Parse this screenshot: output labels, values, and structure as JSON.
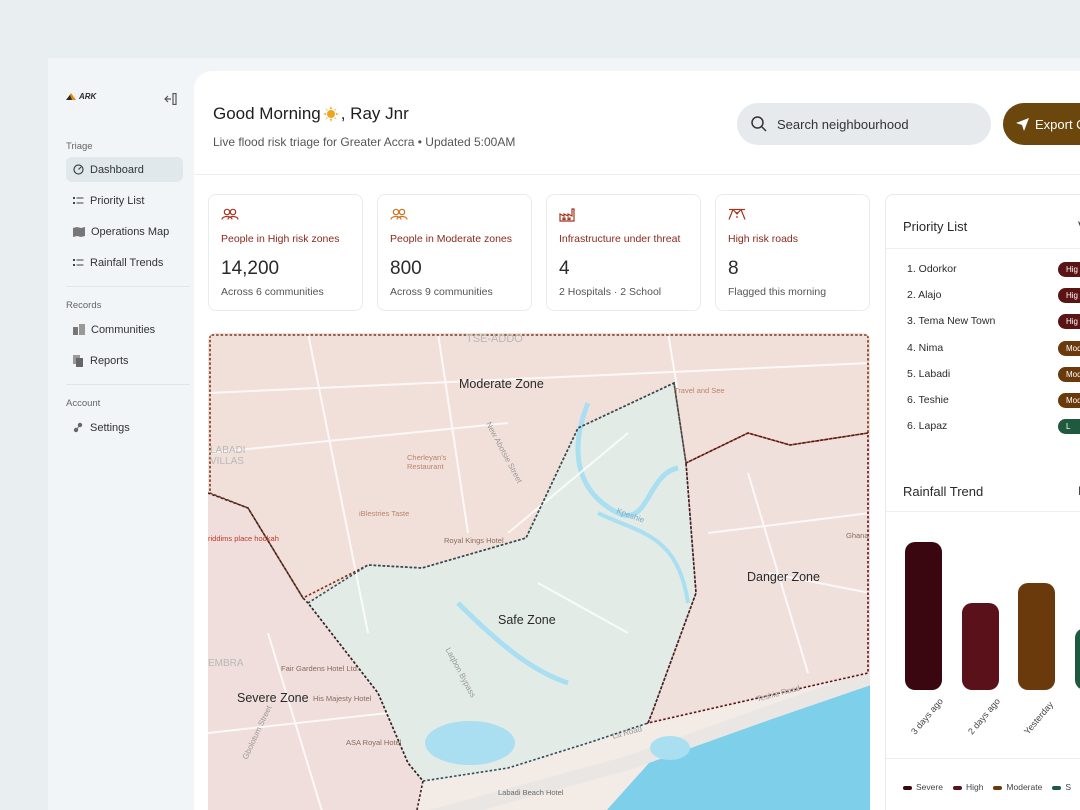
{
  "brand": {
    "name": "ARK"
  },
  "sidebar": {
    "sections": [
      {
        "title": "Triage",
        "items": [
          {
            "label": "Dashboard",
            "icon": "dashboard-icon",
            "active": true
          },
          {
            "label": "Priority List",
            "icon": "list-icon"
          },
          {
            "label": "Operations Map",
            "icon": "map-icon"
          },
          {
            "label": "Rainfall Trends",
            "icon": "list-icon"
          }
        ]
      },
      {
        "title": "Records",
        "items": [
          {
            "label": "Communities",
            "icon": "buildings-icon"
          },
          {
            "label": "Reports",
            "icon": "reports-icon"
          }
        ]
      },
      {
        "title": "Account",
        "items": [
          {
            "label": "Settings",
            "icon": "settings-icon"
          }
        ]
      }
    ]
  },
  "header": {
    "greeting_prefix": "Good Morning",
    "greeting_name": ", Ray Jnr",
    "subtitle": "Live flood risk triage for  Greater Accra • Updated 5:00AM",
    "search_placeholder": "Search neighbourhood",
    "export_label": "Export C"
  },
  "stats": [
    {
      "label": "People in High risk zones",
      "value": "14,200",
      "note": "Across 6 communities",
      "icon": "people-icon"
    },
    {
      "label": "People in Moderate zones",
      "value": "800",
      "note": "Across 9 communities",
      "icon": "people-icon"
    },
    {
      "label": "Infrastructure under threat",
      "value": "4",
      "note": "2 Hospitals · 2 School",
      "icon": "factory-icon"
    },
    {
      "label": "High risk roads",
      "value": "8",
      "note": "Flagged this morning",
      "icon": "road-icon"
    }
  ],
  "map": {
    "zones": [
      "Moderate Zone",
      "Safe Zone",
      "Danger Zone",
      "Severe Zone"
    ],
    "places": [
      "TSE-ADDO",
      "Cherleyan's Restaurant",
      "iBlestries Taste",
      "Royal Kings Hotel",
      "Fair Gardens Hotel Ltd.",
      "His Majesty Hotel",
      "ASA Royal Hotel",
      "Labadi Beach Hotel",
      "Travel and See",
      "Ghana",
      "riddims place hookah"
    ],
    "streets": [
      "New Abotsie Street",
      "Laqbon Bypass",
      "Teshie Road",
      "La Road",
      "Kpeshie",
      "LABADI VILLAS",
      "EMBRA",
      "Gbolotum Street"
    ]
  },
  "priority_list": {
    "title": "Priority List",
    "more": "V",
    "items": [
      {
        "label": "1. Odorkor",
        "badge": "Hig",
        "color": "#5a1414"
      },
      {
        "label": "2. Alajo",
        "badge": "Hig",
        "color": "#5a1414"
      },
      {
        "label": "3. Tema New Town",
        "badge": "Hig",
        "color": "#5a1414"
      },
      {
        "label": "4. Nima",
        "badge": "Mod",
        "color": "#6a3a0c"
      },
      {
        "label": "5. Labadi",
        "badge": "Mod",
        "color": "#6a3a0c"
      },
      {
        "label": "6. Teshie",
        "badge": "Mod",
        "color": "#6a3a0c"
      },
      {
        "label": "6. Lapaz",
        "badge": "L",
        "color": "#1f5a3e"
      }
    ]
  },
  "rainfall": {
    "title": "Rainfall Trend",
    "more": "I",
    "legend": [
      {
        "label": "Severe",
        "color": "#3a0710"
      },
      {
        "label": "High",
        "color": "#5a1119"
      },
      {
        "label": "Moderate",
        "color": "#6a3a0c"
      },
      {
        "label": "S",
        "color": "#1f5a3e"
      }
    ]
  },
  "chart_data": {
    "type": "bar",
    "title": "Rainfall Trend",
    "categories": [
      "3 days ago",
      "2 days ago",
      "Yesterday",
      ""
    ],
    "values": [
      100,
      59,
      72,
      42
    ],
    "value_unit": "relative bar height (unlabeled axis)",
    "colors": [
      "#3a0710",
      "#5a1119",
      "#6a3a0c",
      "#1f5a3e"
    ]
  }
}
